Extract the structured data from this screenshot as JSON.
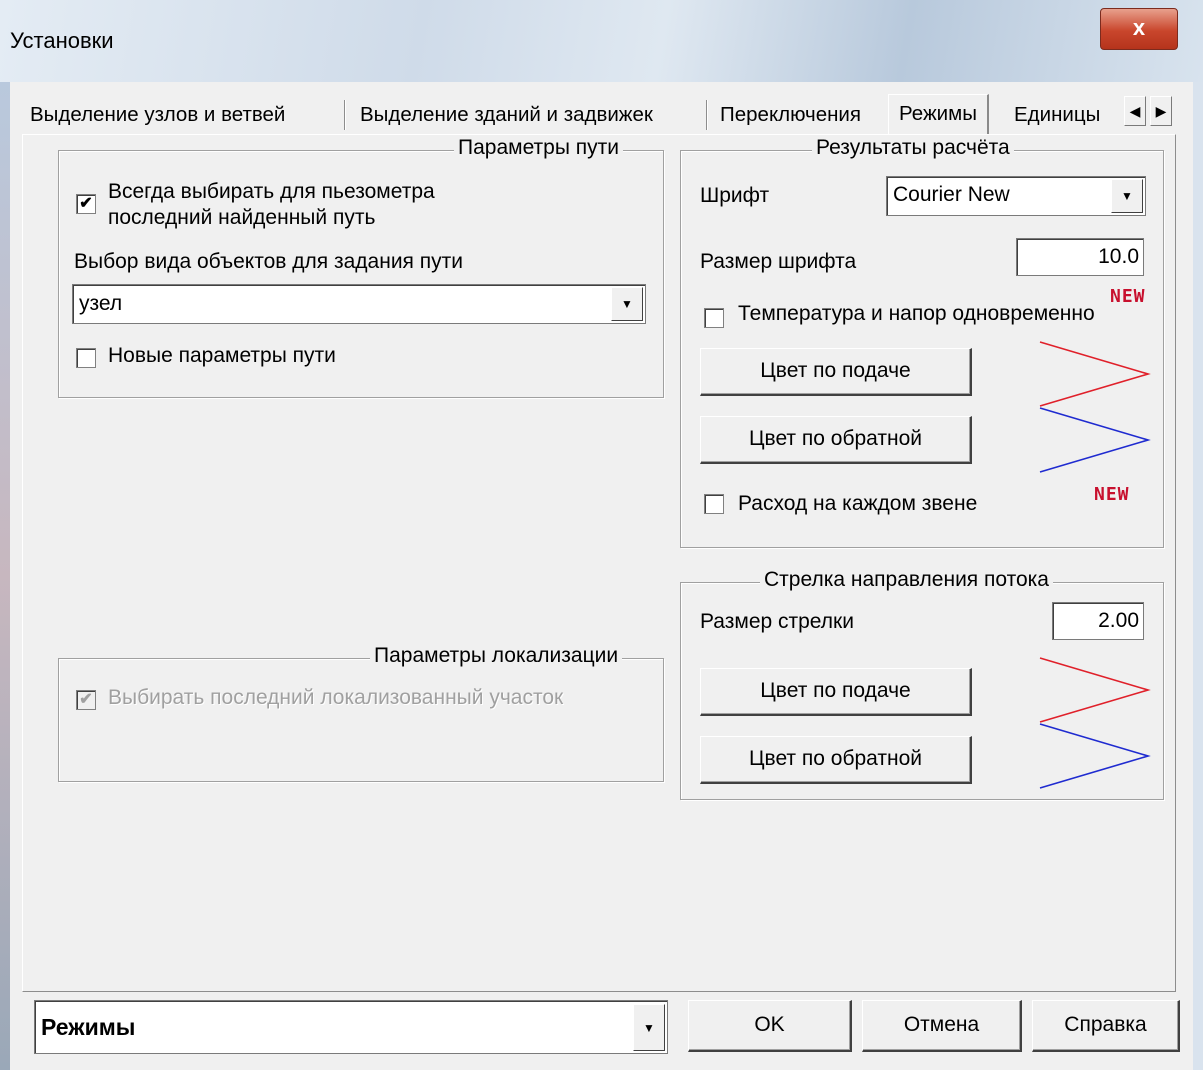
{
  "window": {
    "title": "Установки",
    "close_label": "x"
  },
  "tabs": [
    "Выделение узлов и ветвей",
    "Выделение зданий и задвижек",
    "Переключения",
    "Режимы",
    "Единицы"
  ],
  "active_tab": "Режимы",
  "tab_scroll": {
    "left": "◀",
    "right": "▶"
  },
  "path_params": {
    "legend": "Параметры пути",
    "always_choose_line1": "Всегда выбирать для пьезометра",
    "always_choose_line2": "последний найденный путь",
    "always_choose_checked": "✔",
    "object_type_label": "Выбор вида объектов для задания пути",
    "object_type_value": "узел",
    "new_params_label": "Новые параметры пути"
  },
  "localization_params": {
    "legend": "Параметры локализации",
    "choose_last_label": "Выбирать последний локализованный участок",
    "choose_last_checked": "✔"
  },
  "results": {
    "legend": "Результаты расчёта",
    "font_label": "Шрифт",
    "font_value": "Courier New",
    "font_size_label": "Размер шрифта",
    "font_size_value": "10.0",
    "new_tag": "NEW",
    "temp_pressure_label": "Температура и напор одновременно",
    "supply_color_button": "Цвет по подаче",
    "return_color_button": "Цвет по обратной",
    "flow_each_link_label": "Расход на каждом звене",
    "supply_color": "#e0202a",
    "return_color": "#1f2bd0"
  },
  "flow_arrow": {
    "legend": "Стрелка направления потока",
    "arrow_size_label": "Размер стрелки",
    "arrow_size_value": "2.00",
    "supply_color_button": "Цвет по подаче",
    "return_color_button": "Цвет по обратной"
  },
  "footer": {
    "page_select_value": "Режимы",
    "ok_button": "OK",
    "cancel_button": "Отмена",
    "help_button": "Справка"
  },
  "icons": {
    "dropdown": "▼",
    "scroll_left": "◀",
    "scroll_right": "▶"
  }
}
